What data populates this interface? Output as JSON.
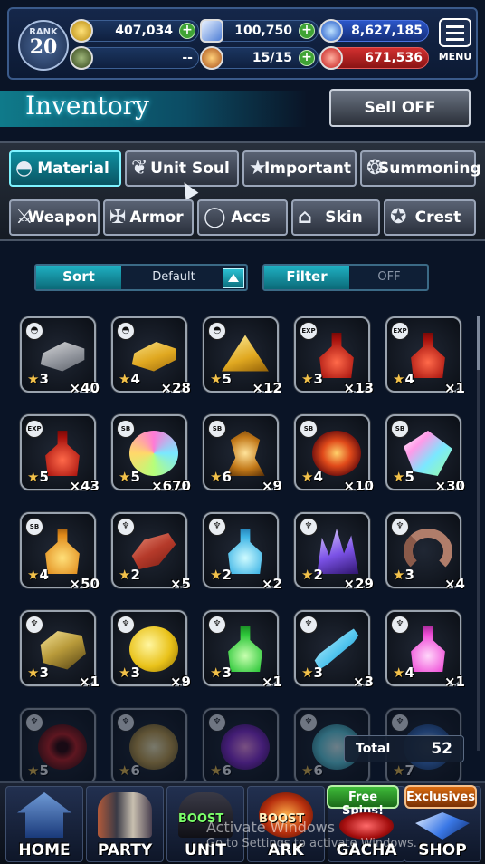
{
  "status": {
    "rank_label": "RANK",
    "rank_value": "20",
    "gil": "407,034",
    "lapis": "100,750",
    "friend_points": "8,627,185",
    "gauge": "--",
    "energy": "15/15",
    "energy_max_color": "#5ee05a",
    "red_value": "671,536",
    "menu_label": "MENU"
  },
  "header": {
    "title": "Inventory",
    "sell_label": "Sell OFF"
  },
  "tabs": [
    {
      "label": "Material",
      "icon": "material-icon",
      "active": true
    },
    {
      "label": "Unit Soul",
      "icon": "unit-soul-icon",
      "active": false
    },
    {
      "label": "Important",
      "icon": "star-icon",
      "active": false
    },
    {
      "label": "Summoning",
      "icon": "summoning-icon",
      "active": false
    },
    {
      "label": "Weapon",
      "icon": "sword-icon",
      "active": false
    },
    {
      "label": "Armor",
      "icon": "armor-icon",
      "active": false
    },
    {
      "label": "Accs",
      "icon": "ring-icon",
      "active": false
    },
    {
      "label": "Skin",
      "icon": "hanger-icon",
      "active": false
    },
    {
      "label": "Crest",
      "icon": "crest-icon",
      "active": false
    }
  ],
  "sort": {
    "label": "Sort",
    "value": "Default"
  },
  "filter": {
    "label": "Filter",
    "value": "OFF"
  },
  "items": [
    {
      "art": "ingot",
      "badge": "material",
      "stars": "3",
      "qty": "×40"
    },
    {
      "art": "gold",
      "badge": "material",
      "stars": "4",
      "qty": "×28"
    },
    {
      "art": "pyr",
      "badge": "material",
      "stars": "5",
      "qty": "×12"
    },
    {
      "art": "potion-red",
      "badge": "exp",
      "stars": "3",
      "qty": "×13"
    },
    {
      "art": "potion-red",
      "badge": "exp",
      "stars": "4",
      "qty": "×1"
    },
    {
      "art": "potion-red",
      "badge": "exp",
      "stars": "5",
      "qty": "×43"
    },
    {
      "art": "rainbow",
      "badge": "sb",
      "stars": "5",
      "qty": "×670"
    },
    {
      "art": "relic",
      "badge": "sb",
      "stars": "6",
      "qty": "×9"
    },
    {
      "art": "orb-swirl",
      "badge": "sb",
      "stars": "4",
      "qty": "×10"
    },
    {
      "art": "crystal",
      "badge": "sb",
      "stars": "5",
      "qty": "×30"
    },
    {
      "art": "flask-gold",
      "badge": "sb",
      "stars": "4",
      "qty": "×50"
    },
    {
      "art": "meat",
      "badge": "awaken",
      "stars": "2",
      "qty": "×5"
    },
    {
      "art": "bottle-blue",
      "badge": "awaken",
      "stars": "2",
      "qty": "×2"
    },
    {
      "art": "amethyst",
      "badge": "awaken",
      "stars": "2",
      "qty": "×29"
    },
    {
      "art": "horn",
      "badge": "awaken",
      "stars": "3",
      "qty": "×4"
    },
    {
      "art": "rock",
      "badge": "awaken",
      "stars": "3",
      "qty": "×1"
    },
    {
      "art": "apple",
      "badge": "awaken",
      "stars": "3",
      "qty": "×9"
    },
    {
      "art": "bottle-green",
      "badge": "awaken",
      "stars": "3",
      "qty": "×1"
    },
    {
      "art": "bone",
      "badge": "awaken",
      "stars": "3",
      "qty": "×3"
    },
    {
      "art": "bottle-pink",
      "badge": "awaken",
      "stars": "4",
      "qty": "×1"
    },
    {
      "art": "eye",
      "badge": "awaken",
      "stars": "5",
      "qty": ""
    },
    {
      "art": "sphere-gold",
      "badge": "awaken",
      "stars": "6",
      "qty": ""
    },
    {
      "art": "sphere-purple",
      "badge": "awaken",
      "stars": "6",
      "qty": ""
    },
    {
      "art": "sphere-cyan",
      "badge": "awaken",
      "stars": "6",
      "qty": ""
    },
    {
      "art": "sphere-blue",
      "badge": "awaken",
      "stars": "7",
      "qty": ""
    }
  ],
  "total": {
    "label": "Total",
    "value": "52"
  },
  "nav": [
    {
      "label": "HOME",
      "icon": "home-icon"
    },
    {
      "label": "PARTY",
      "icon": "party-icon"
    },
    {
      "label": "UNIT",
      "icon": "unit-icon",
      "boost": "BOOST"
    },
    {
      "label": "ARK",
      "icon": "ark-icon",
      "boost": "BOOST"
    },
    {
      "label": "GACHA",
      "icon": "gacha-icon",
      "pill": "Free Spins!"
    },
    {
      "label": "SHOP",
      "icon": "shop-icon",
      "pill": "Exclusives"
    }
  ],
  "watermark": {
    "line1": "Activate Windows",
    "line2": "Go to Settings to activate Windows."
  }
}
